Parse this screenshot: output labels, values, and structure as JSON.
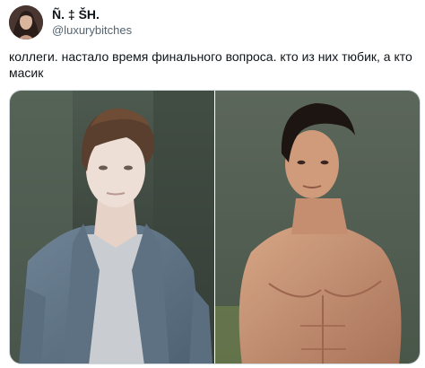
{
  "author": {
    "display_name": "Ñ. ‡ ŠH.",
    "handle": "@luxurybitches",
    "avatar_icon": "profile-avatar"
  },
  "tweet": {
    "text": "коллеги. настало время финального вопроса. кто из них тюбик, а кто масик"
  },
  "media": {
    "photos": [
      {
        "subject": "pale man with tousled hair in grey shirt"
      },
      {
        "subject": "shirtless muscular man with dark hair in forest"
      }
    ]
  },
  "colors": {
    "text_primary": "#0f1419",
    "text_secondary": "#536471",
    "border": "#cfd9de"
  }
}
